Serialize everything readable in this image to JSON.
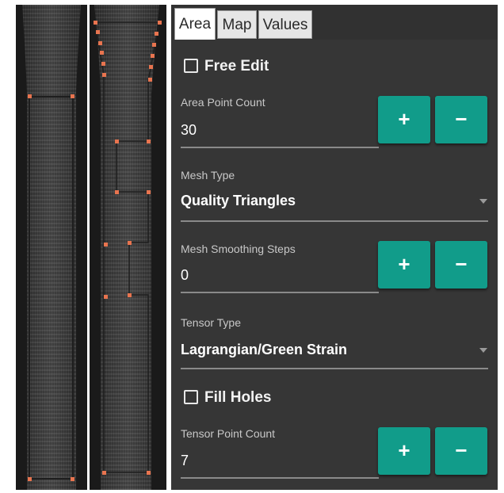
{
  "tabs": [
    {
      "label": "Area",
      "active": true
    },
    {
      "label": "Map",
      "active": false
    },
    {
      "label": "Values",
      "active": false
    }
  ],
  "settings": {
    "free_edit": {
      "label": "Free Edit",
      "checked": false
    },
    "area_point_count": {
      "label": "Area Point Count",
      "value": "30",
      "increment_label": "+",
      "decrement_label": "−"
    },
    "mesh_type": {
      "label": "Mesh Type",
      "value": "Quality Triangles"
    },
    "mesh_smoothing_steps": {
      "label": "Mesh Smoothing Steps",
      "value": "0",
      "increment_label": "+",
      "decrement_label": "−"
    },
    "tensor_type": {
      "label": "Tensor Type",
      "value": "Lagrangian/Green Strain"
    },
    "fill_holes": {
      "label": "Fill Holes",
      "checked": false
    },
    "tensor_point_count": {
      "label": "Tensor Point Count",
      "value": "7",
      "increment_label": "+",
      "decrement_label": "−"
    }
  },
  "colors": {
    "accent": "#119c8a",
    "panel_bg": "#363636",
    "area_points": "#e8744f"
  },
  "icons": {
    "checkbox": "checkbox-icon",
    "dropdown": "chevron-down-icon"
  }
}
